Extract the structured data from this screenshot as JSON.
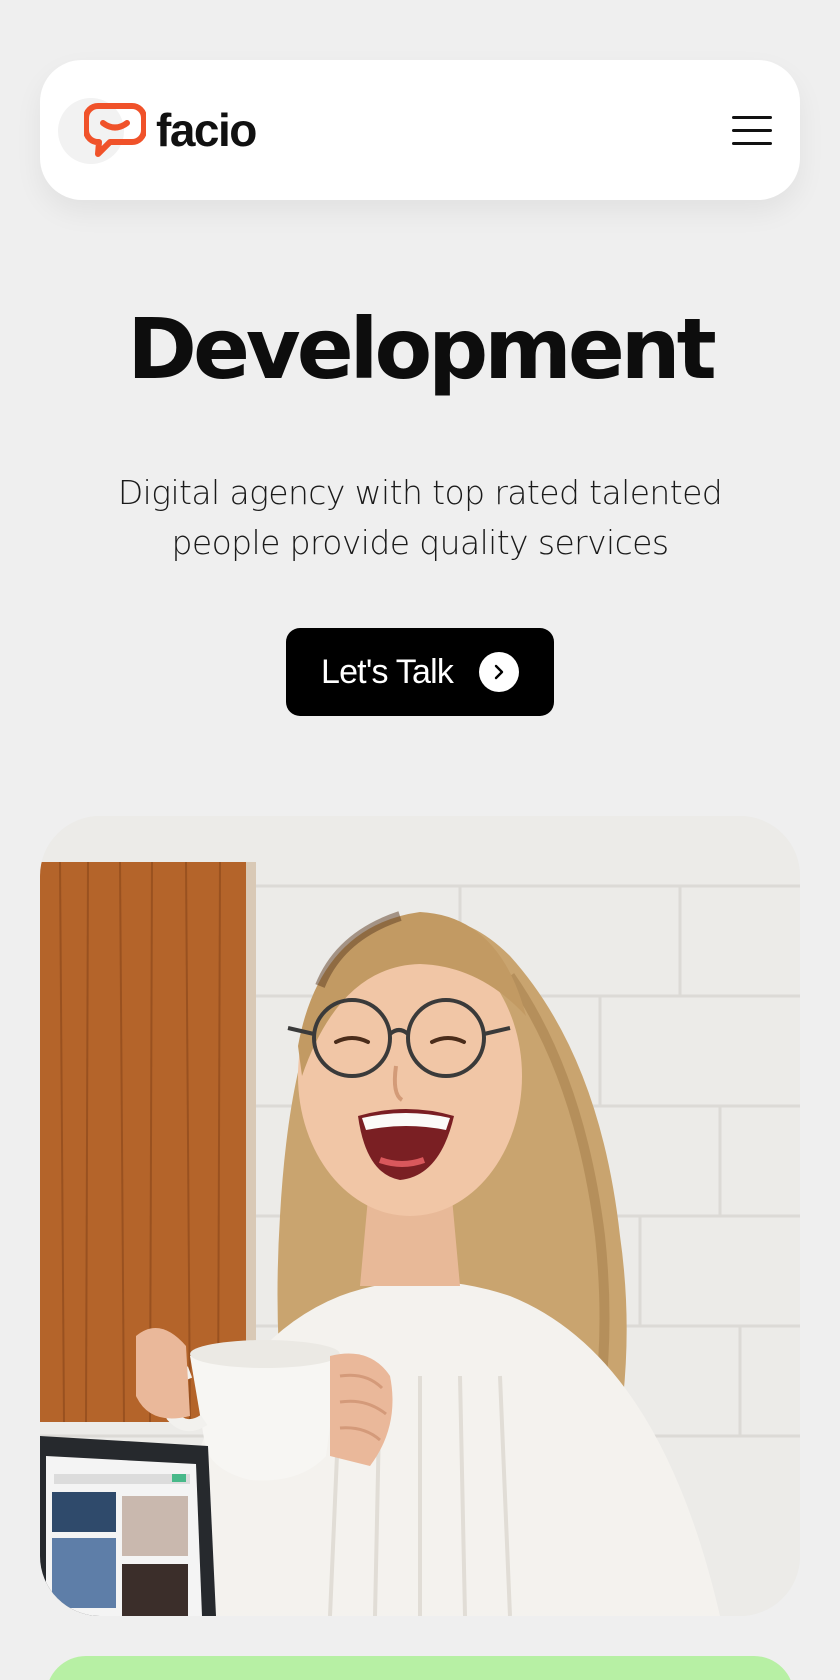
{
  "header": {
    "brand_name": "facio",
    "logo_icon": "chat-bubble-icon",
    "menu_icon": "hamburger-menu-icon",
    "accent_color": "#f0522a"
  },
  "hero": {
    "title": "Development",
    "subtitle": "Digital agency with top rated talented people provide quality services",
    "cta_label": "Let's Talk",
    "cta_icon": "chevron-right-icon"
  },
  "colors": {
    "background": "#efefef",
    "cta_background": "#000000",
    "next_section": "#b7f0a4"
  }
}
